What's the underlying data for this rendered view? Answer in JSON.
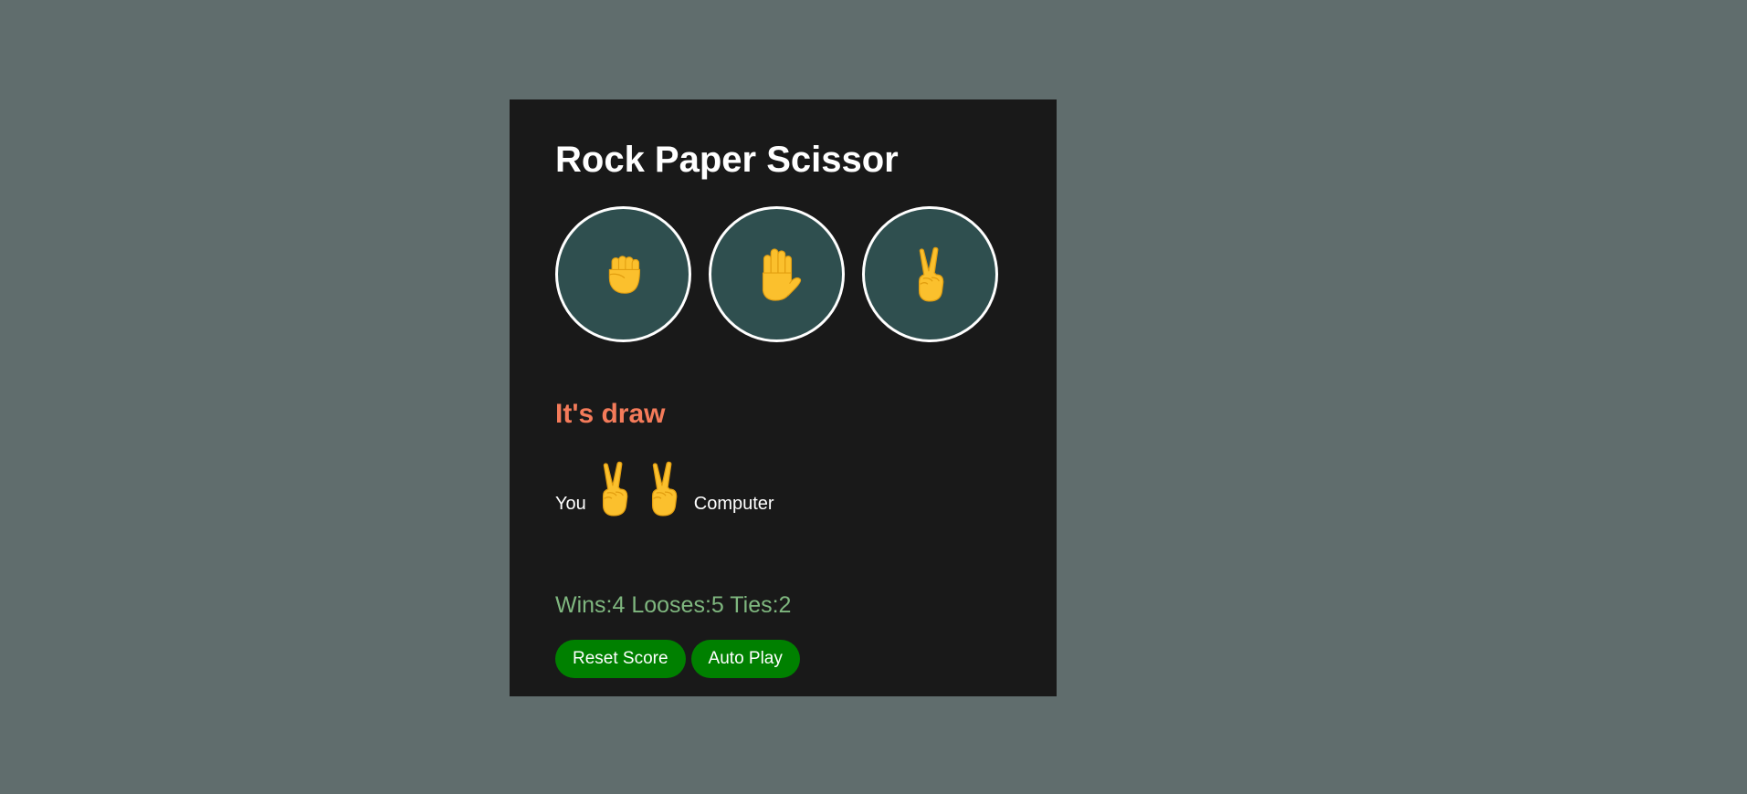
{
  "game": {
    "title": "Rock Paper Scissor",
    "choices": [
      {
        "name": "rock",
        "icon": "raised-fist-icon"
      },
      {
        "name": "paper",
        "icon": "raised-hand-icon"
      },
      {
        "name": "scissors",
        "icon": "victory-hand-icon"
      }
    ],
    "result_text": "It's draw",
    "moves": {
      "you_label": "You",
      "you_move_icon": "victory-hand-icon",
      "computer_move_icon": "victory-hand-icon",
      "computer_label": "Computer"
    },
    "score_text": "Wins:4 Looses:5 Ties:2",
    "buttons": {
      "reset_label": "Reset Score",
      "auto_play_label": "Auto Play"
    }
  },
  "colors": {
    "page_background": "#606d6d",
    "card_background": "#191919",
    "choice_background": "#2f4f4f",
    "result_color": "#f47b5a",
    "score_color": "#7fb77f",
    "button_color": "#008000",
    "emoji_yellow": "#fbc02d"
  }
}
